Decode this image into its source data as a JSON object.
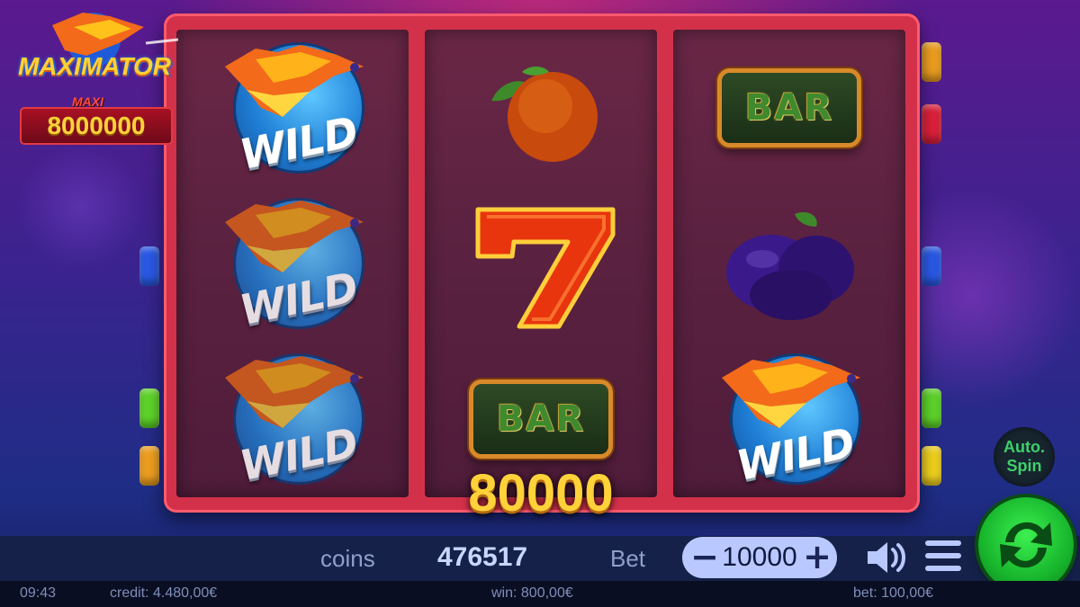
{
  "game": {
    "logo_title": "MAXIMATOR",
    "jackpot_label": "MAXI",
    "jackpot_value": "8000000"
  },
  "reels": [
    [
      "WILD",
      "WILD",
      "WILD"
    ],
    [
      "orange",
      "seven",
      "BAR"
    ],
    [
      "BAR",
      "plum",
      "WILD"
    ]
  ],
  "symbol_text": {
    "wild": "WILD",
    "bar": "BAR"
  },
  "win_amount": "80000",
  "autospin": {
    "line1": "Auto.",
    "line2": "Spin"
  },
  "controls": {
    "coins_label": "coins",
    "coins_value": "476517",
    "bet_label": "Bet",
    "bet_minus": "−",
    "bet_value": "10000",
    "bet_plus": "+"
  },
  "status": {
    "time": "09:43",
    "credit": "credit: 4.480,00€",
    "win": "win: 800,00€",
    "bet": "bet: 100,00€"
  },
  "colors": {
    "frame": "#d3314a",
    "win_text": "#ffd23a",
    "spin_button": "#17b52c"
  }
}
